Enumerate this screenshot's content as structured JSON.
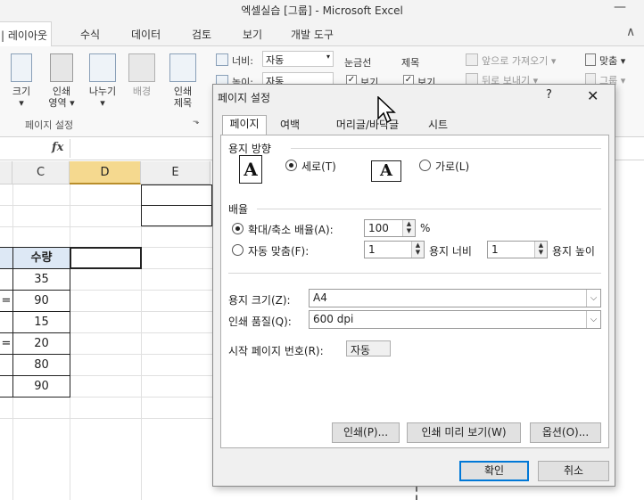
{
  "window": {
    "title": "엑셀실습 [그룹] - Microsoft Excel",
    "minimize_glyph": "—"
  },
  "tabs": [
    {
      "label": "| 레이아웃",
      "active": true
    },
    {
      "label": "수식"
    },
    {
      "label": "데이터"
    },
    {
      "label": "검토"
    },
    {
      "label": "보기"
    },
    {
      "label": "개발 도구"
    }
  ],
  "tabs_expand_glyph": "∧",
  "ribbon": {
    "page_setup_group": {
      "buttons": [
        {
          "label": "크기",
          "sub": "▾"
        },
        {
          "label": "인쇄",
          "sub": "영역 ▾"
        },
        {
          "label": "나누기",
          "sub": "▾"
        },
        {
          "label": "배경",
          "sub": ""
        },
        {
          "label": "인쇄",
          "sub": "제목"
        }
      ],
      "group_label": "페이지 설정",
      "launcher_glyph": "⬎"
    },
    "scale_group": {
      "width_label": "너비:",
      "width_value": "자동",
      "height_label": "높이:",
      "height_value": "자동"
    },
    "gridlines": {
      "label": "눈금선",
      "view_label": "보기",
      "checked": true
    },
    "headings": {
      "label": "제목",
      "view_label": "보기",
      "checked": true
    },
    "arrange": {
      "bring_forward": "앞으로 가져오기 ▾",
      "send_backward": "뒤로 보내기 ▾",
      "align": "맞춤 ▾",
      "group": "그룹 ▾"
    }
  },
  "formula_bar": {
    "fx": "fx"
  },
  "columns": [
    "C",
    "D",
    "E"
  ],
  "selected_column": "D",
  "table": {
    "header": "수량",
    "values": [
      "35",
      "90",
      "15",
      "20",
      "80",
      "90"
    ],
    "left_marks": [
      "",
      "=",
      "",
      "=",
      "",
      ""
    ]
  },
  "dialog": {
    "title": "페이지 설정",
    "help_glyph": "?",
    "close_glyph": "✕",
    "tabs": [
      "페이지",
      "여백",
      "머리글/바닥글",
      "시트"
    ],
    "active_tab": "페이지",
    "orientation": {
      "label": "용지 방향",
      "portrait": "세로(T)",
      "landscape": "가로(L)",
      "selected": "portrait",
      "icon_letter": "A"
    },
    "scaling": {
      "label": "배율",
      "adjust_label": "확대/축소 배율(A):",
      "adjust_value": "100",
      "percent": "%",
      "fit_label": "자동 맞춤(F):",
      "fit_width_value": "1",
      "fit_width_label": "용지 너비",
      "fit_height_value": "1",
      "fit_height_label": "용지 높이",
      "selected": "adjust"
    },
    "paper_size": {
      "label": "용지 크기(Z):",
      "value": "A4"
    },
    "print_quality": {
      "label": "인쇄 품질(Q):",
      "value": "600 dpi"
    },
    "first_page": {
      "label": "시작 페이지 번호(R):",
      "value": "자동"
    },
    "buttons": {
      "print": "인쇄(P)...",
      "preview": "인쇄 미리 보기(W)",
      "options": "옵션(O)...",
      "ok": "확인",
      "cancel": "취소"
    }
  }
}
